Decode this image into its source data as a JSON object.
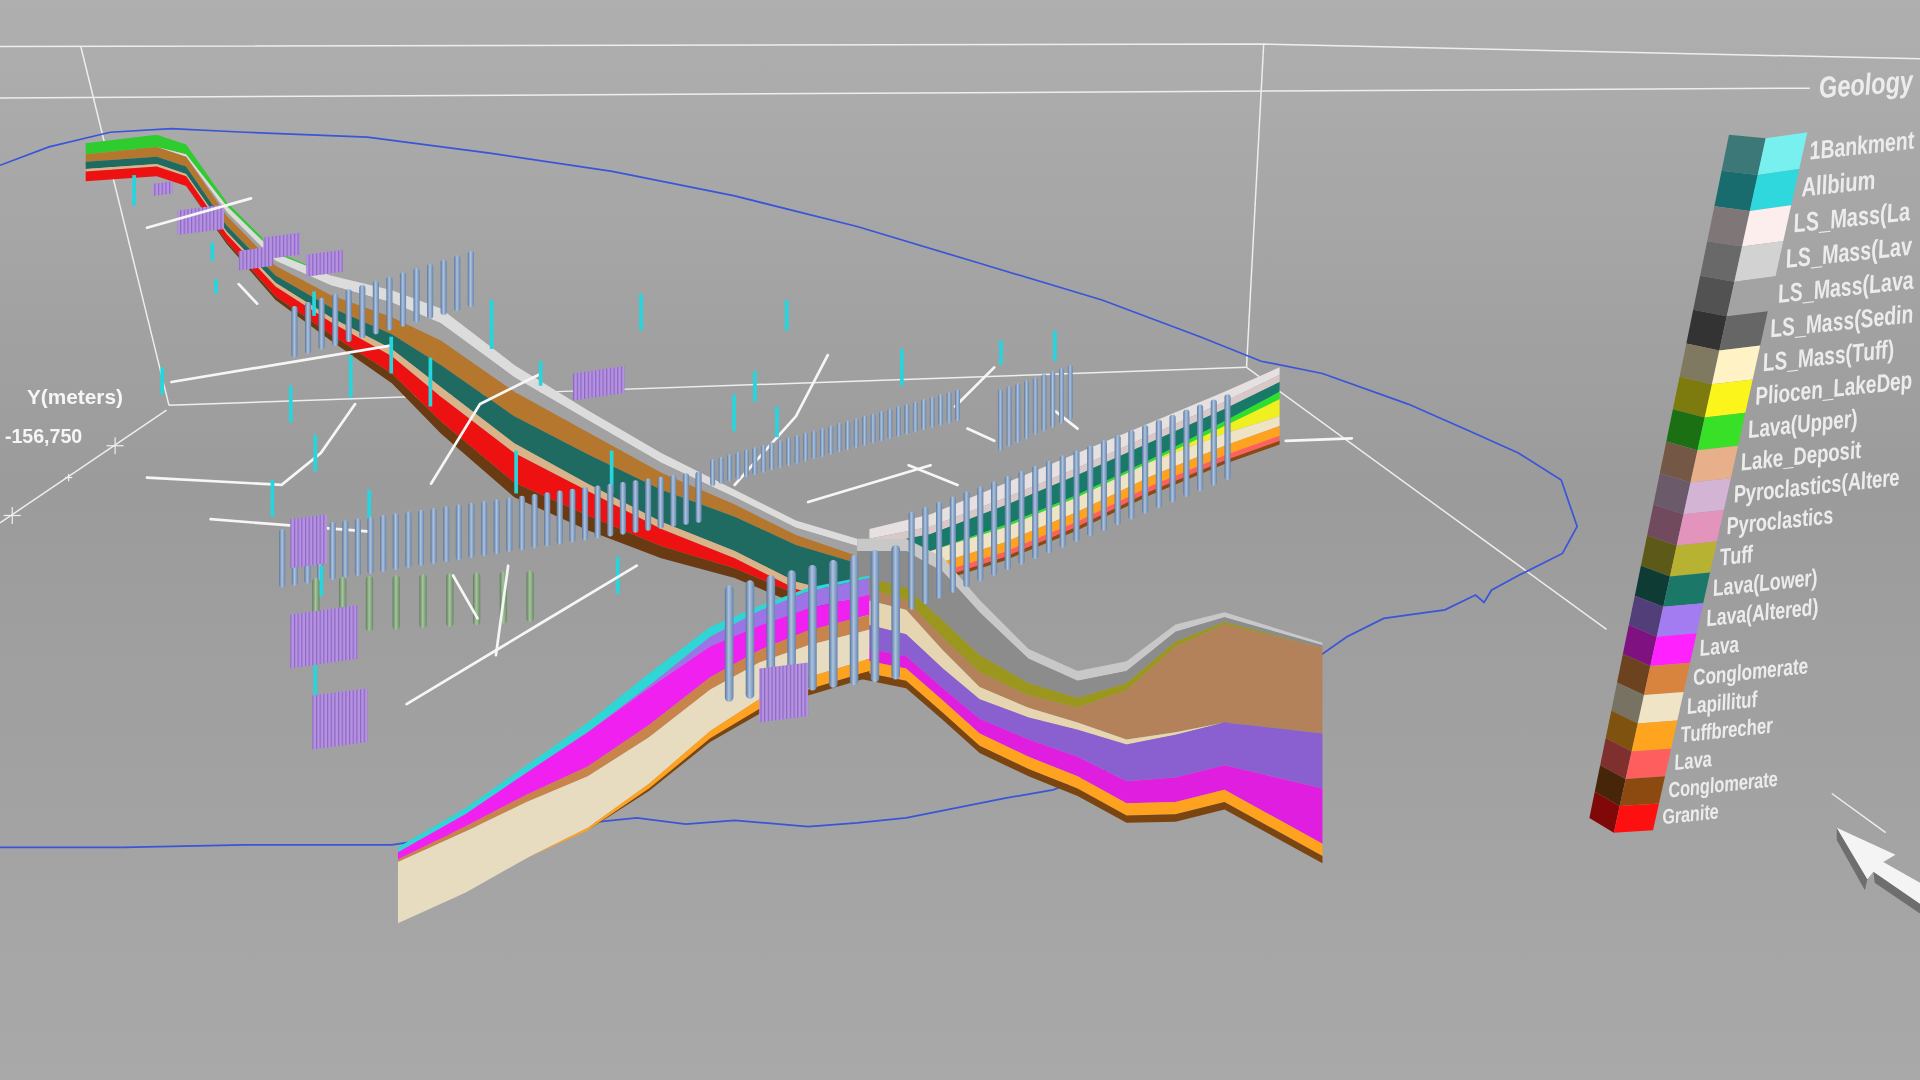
{
  "legend": {
    "title": "Geology",
    "items": [
      {
        "label": "1Bankment",
        "color": "#78f0f0"
      },
      {
        "label": "Allbium",
        "color": "#2fd8dc"
      },
      {
        "label": "LS_Mass(La",
        "color": "#fdeeee"
      },
      {
        "label": "LS_Mass(Lav",
        "color": "#d2d2d2"
      },
      {
        "label": "LS_Mass(Lava",
        "color": "#a3a3a3"
      },
      {
        "label": "LS_Mass(Sedin",
        "color": "#666666"
      },
      {
        "label": "LS_Mass(Tuff)",
        "color": "#fff2c4"
      },
      {
        "label": "Pliocen_LakeDep",
        "color": "#fbf51c"
      },
      {
        "label": "Lava(Upper)",
        "color": "#38e028"
      },
      {
        "label": "Lake_Deposit",
        "color": "#e8b08a"
      },
      {
        "label": "Pyroclastics(Altere",
        "color": "#d4b4d4"
      },
      {
        "label": "Pyroclastics",
        "color": "#e294bc"
      },
      {
        "label": "Tuff",
        "color": "#b8b232"
      },
      {
        "label": "Lava(Lower)",
        "color": "#1b7869"
      },
      {
        "label": "Lava(Altered)",
        "color": "#a47cf2"
      },
      {
        "label": "Lava",
        "color": "#ff22ff"
      },
      {
        "label": "Conglomerate",
        "color": "#d8843e"
      },
      {
        "label": "Lapillituf",
        "color": "#f0e4c6"
      },
      {
        "label": "Tuffbrecher",
        "color": "#ffa41e"
      },
      {
        "label": "Lava",
        "color": "#ff5e5e"
      },
      {
        "label": "Conglomerate",
        "color": "#8c4a10"
      },
      {
        "label": "Granite",
        "color": "#ff1010"
      }
    ]
  },
  "axis": {
    "title": "Y(meters)",
    "tick_label": "-156,750"
  }
}
